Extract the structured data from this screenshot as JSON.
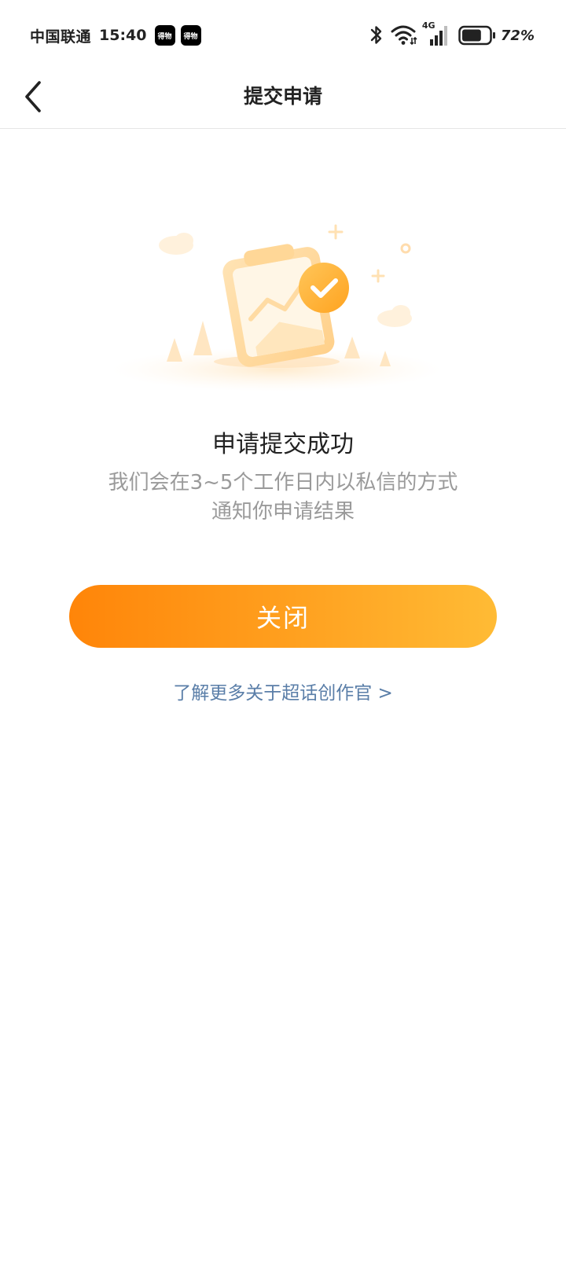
{
  "status_bar": {
    "carrier": "中国联通",
    "time": "15:40",
    "app_badges": [
      "得物",
      "得物"
    ],
    "network_type": "4G",
    "battery_percent": "72%",
    "battery_level": 0.72,
    "icons": [
      "bluetooth-icon",
      "wifi-icon",
      "signal-icon",
      "battery-icon"
    ]
  },
  "nav": {
    "back_icon": "chevron-left-icon",
    "title": "提交申请"
  },
  "result": {
    "illustration": "clipboard-check-illustration",
    "title": "申请提交成功",
    "description_line1": "我们会在3~5个工作日内以私信的方式",
    "description_line2": "通知你申请结果"
  },
  "actions": {
    "close_label": "关闭",
    "learn_more_label": "了解更多关于超话创作官 >"
  },
  "colors": {
    "accent_start": "#ff8509",
    "accent_end": "#ffbb35",
    "link": "#5a7ea8"
  }
}
